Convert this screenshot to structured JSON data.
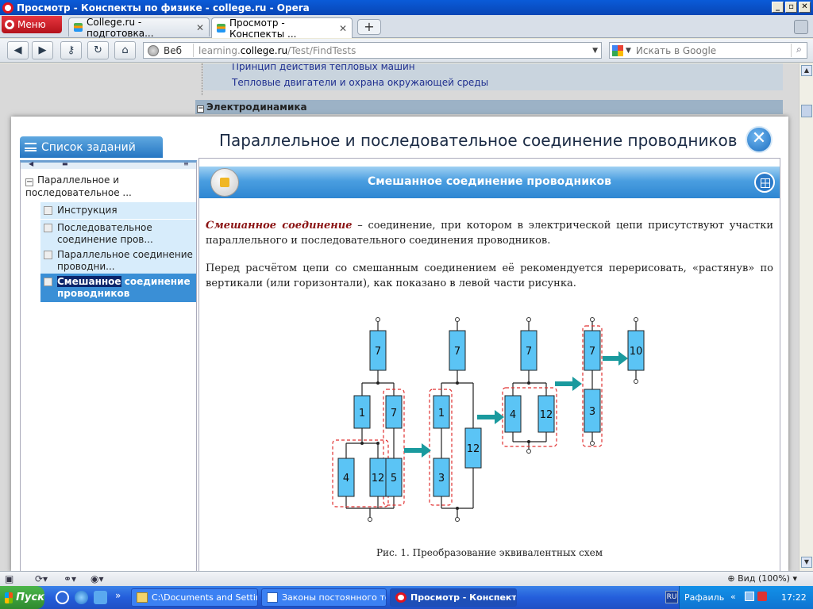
{
  "window": {
    "title": "Просмотр - Конспекты по физике - college.ru - Opera",
    "min_label": "_",
    "max_label": "▫",
    "close_label": "✕"
  },
  "tabbar": {
    "menu_label": "Меню",
    "tabs": [
      {
        "label": "College.ru - подготовка...",
        "close": "✕"
      },
      {
        "label": "Просмотр - Конспекты ...",
        "close": "✕"
      }
    ],
    "new_tab": "+"
  },
  "navbar": {
    "back": "◀",
    "forward": "▶",
    "key": "⚷",
    "reload": "↻",
    "home": "⌂",
    "web_label": "Веб",
    "url_prefix": "learning.",
    "url_host": "college.ru",
    "url_path": "/Test/FindTests",
    "search_placeholder": "Искать в Google"
  },
  "background_page": {
    "rows": [
      "Принцип действия тепловых машин",
      "Тепловые двигатели и охрана окружающей среды"
    ],
    "section_head": "Электродинамика",
    "section_toggle": "−"
  },
  "modal": {
    "sidebar_tab": "Список заданий",
    "title": "Параллельное и последовательное соединение проводников",
    "close": "✕",
    "tree": {
      "toggle": "−",
      "root": "Параллельное и последовательное ...",
      "items": [
        {
          "label": "Инструкция"
        },
        {
          "label": "Последовательное соединение пров..."
        },
        {
          "label": "Параллельное соединение проводни..."
        },
        {
          "label_hl": "Смешанное",
          "label_rest": " соединение проводников"
        }
      ]
    },
    "content": {
      "banner_title": "Смешанное соединение проводников",
      "p1_term": "Смешанное соединение",
      "p1_rest": " – соединение, при котором в электрической цепи присутствуют участки параллельного и последовательного соединения проводников.",
      "p2": "Перед расчётом цепи со смешанным соединением её рекомендуется перерисовать, «растянув» по вертикали (или горизонтали), как показано в левой части рисунка.",
      "caption": "Рис. 1. Преобразование эквивалентных схем",
      "diagram": {
        "r7": "7",
        "r1": "1",
        "r4": "4",
        "r12": "12",
        "r5": "5",
        "r3": "3",
        "r10": "10"
      }
    }
  },
  "statusbar": {
    "zoom": "Вид (100%)"
  },
  "taskbar": {
    "start": "Пуск",
    "tasks": [
      "C:\\Documents and Settin...",
      "Законы постоянного то...",
      "Просмотр - Конспект..."
    ],
    "lang": "RU",
    "user": "Рафаиль",
    "time": "17:22"
  },
  "colors": {
    "accent": "#2e86d2",
    "resistor": "#5bc4f5",
    "arrow": "#1a9a9e",
    "dashed": "#e03030"
  }
}
